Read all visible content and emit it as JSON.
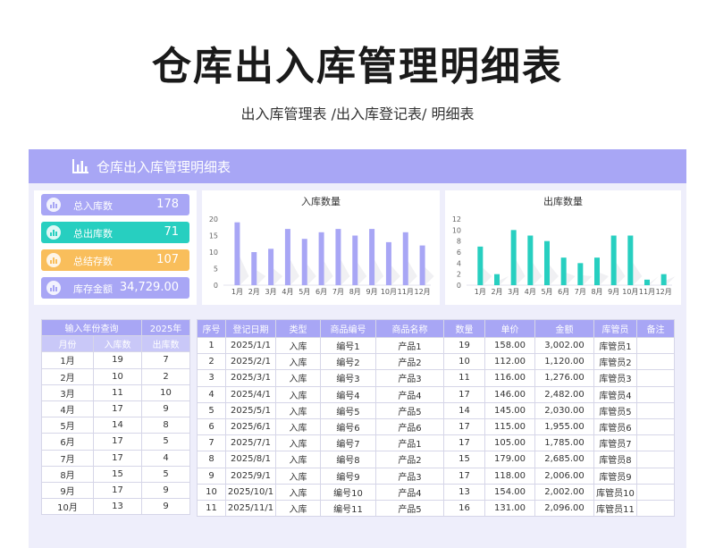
{
  "title": "仓库出入库管理明细表",
  "subtitle": "出入库管理表 /出入库登记表/ 明细表",
  "colors": {
    "accent": "#a8a6f5",
    "teal": "#27cfc0",
    "orange": "#f9be5b",
    "text": "#333333"
  },
  "sheet": {
    "header_title": "仓库出入库管理明细表",
    "header_icon": "bar-chart-icon"
  },
  "kpis": [
    {
      "label": "总入库数",
      "value": "178",
      "color": "#a8a6f5",
      "icon": "inbound-icon"
    },
    {
      "label": "总出库数",
      "value": "71",
      "color": "#27cfc0",
      "icon": "outbound-icon"
    },
    {
      "label": "总结存数",
      "value": "107",
      "color": "#f9be5b",
      "icon": "stock-icon"
    },
    {
      "label": "库存金额",
      "value": "34,729.00",
      "color": "#a8a6f5",
      "icon": "money-icon"
    }
  ],
  "chart_data": [
    {
      "type": "bar",
      "title": "入库数量",
      "categories": [
        "1月",
        "2月",
        "3月",
        "4月",
        "5月",
        "6月",
        "7月",
        "8月",
        "9月",
        "10月",
        "11月",
        "12月"
      ],
      "values": [
        19,
        10,
        11,
        17,
        14,
        16,
        17,
        15,
        17,
        13,
        16,
        12
      ],
      "yticks": [
        0,
        5,
        10,
        15,
        20
      ],
      "ylim": [
        0,
        20
      ],
      "color": "#a8a6f5",
      "grid": false
    },
    {
      "type": "bar",
      "title": "出库数量",
      "categories": [
        "1月",
        "2月",
        "3月",
        "4月",
        "5月",
        "6月",
        "7月",
        "8月",
        "9月",
        "10月",
        "11月",
        "12月"
      ],
      "values": [
        7,
        2,
        10,
        9,
        8,
        5,
        4,
        5,
        9,
        9,
        1,
        2
      ],
      "yticks": [
        0,
        2,
        4,
        6,
        8,
        10,
        12
      ],
      "ylim": [
        0,
        12
      ],
      "color": "#27cfc0",
      "grid": false
    }
  ],
  "month_table": {
    "query_label": "输入年份查询",
    "year": "2025年",
    "headers": [
      "月份",
      "入库数",
      "出库数"
    ],
    "rows": [
      [
        "1月",
        "19",
        "7"
      ],
      [
        "2月",
        "10",
        "2"
      ],
      [
        "3月",
        "11",
        "10"
      ],
      [
        "4月",
        "17",
        "9"
      ],
      [
        "5月",
        "14",
        "8"
      ],
      [
        "6月",
        "17",
        "5"
      ],
      [
        "7月",
        "17",
        "4"
      ],
      [
        "8月",
        "15",
        "5"
      ],
      [
        "9月",
        "17",
        "9"
      ],
      [
        "10月",
        "13",
        "9"
      ]
    ]
  },
  "ledger_table": {
    "headers": [
      "序号",
      "登记日期",
      "类型",
      "商品编号",
      "商品名称",
      "数量",
      "单价",
      "金额",
      "库管员",
      "备注"
    ],
    "rows": [
      [
        "1",
        "2025/1/1",
        "入库",
        "编号1",
        "产品1",
        "19",
        "158.00",
        "3,002.00",
        "库管员1",
        ""
      ],
      [
        "2",
        "2025/2/1",
        "入库",
        "编号2",
        "产品2",
        "10",
        "112.00",
        "1,120.00",
        "库管员2",
        ""
      ],
      [
        "3",
        "2025/3/1",
        "入库",
        "编号3",
        "产品3",
        "11",
        "116.00",
        "1,276.00",
        "库管员3",
        ""
      ],
      [
        "4",
        "2025/4/1",
        "入库",
        "编号4",
        "产品4",
        "17",
        "146.00",
        "2,482.00",
        "库管员4",
        ""
      ],
      [
        "5",
        "2025/5/1",
        "入库",
        "编号5",
        "产品5",
        "14",
        "145.00",
        "2,030.00",
        "库管员5",
        ""
      ],
      [
        "6",
        "2025/6/1",
        "入库",
        "编号6",
        "产品6",
        "17",
        "115.00",
        "1,955.00",
        "库管员6",
        ""
      ],
      [
        "7",
        "2025/7/1",
        "入库",
        "编号7",
        "产品1",
        "17",
        "105.00",
        "1,785.00",
        "库管员7",
        ""
      ],
      [
        "8",
        "2025/8/1",
        "入库",
        "编号8",
        "产品2",
        "15",
        "179.00",
        "2,685.00",
        "库管员8",
        ""
      ],
      [
        "9",
        "2025/9/1",
        "入库",
        "编号9",
        "产品3",
        "17",
        "118.00",
        "2,006.00",
        "库管员9",
        ""
      ],
      [
        "10",
        "2025/10/1",
        "入库",
        "编号10",
        "产品4",
        "13",
        "154.00",
        "2,002.00",
        "库管员10",
        ""
      ],
      [
        "11",
        "2025/11/1",
        "入库",
        "编号11",
        "产品5",
        "16",
        "131.00",
        "2,096.00",
        "库管员11",
        ""
      ]
    ]
  }
}
